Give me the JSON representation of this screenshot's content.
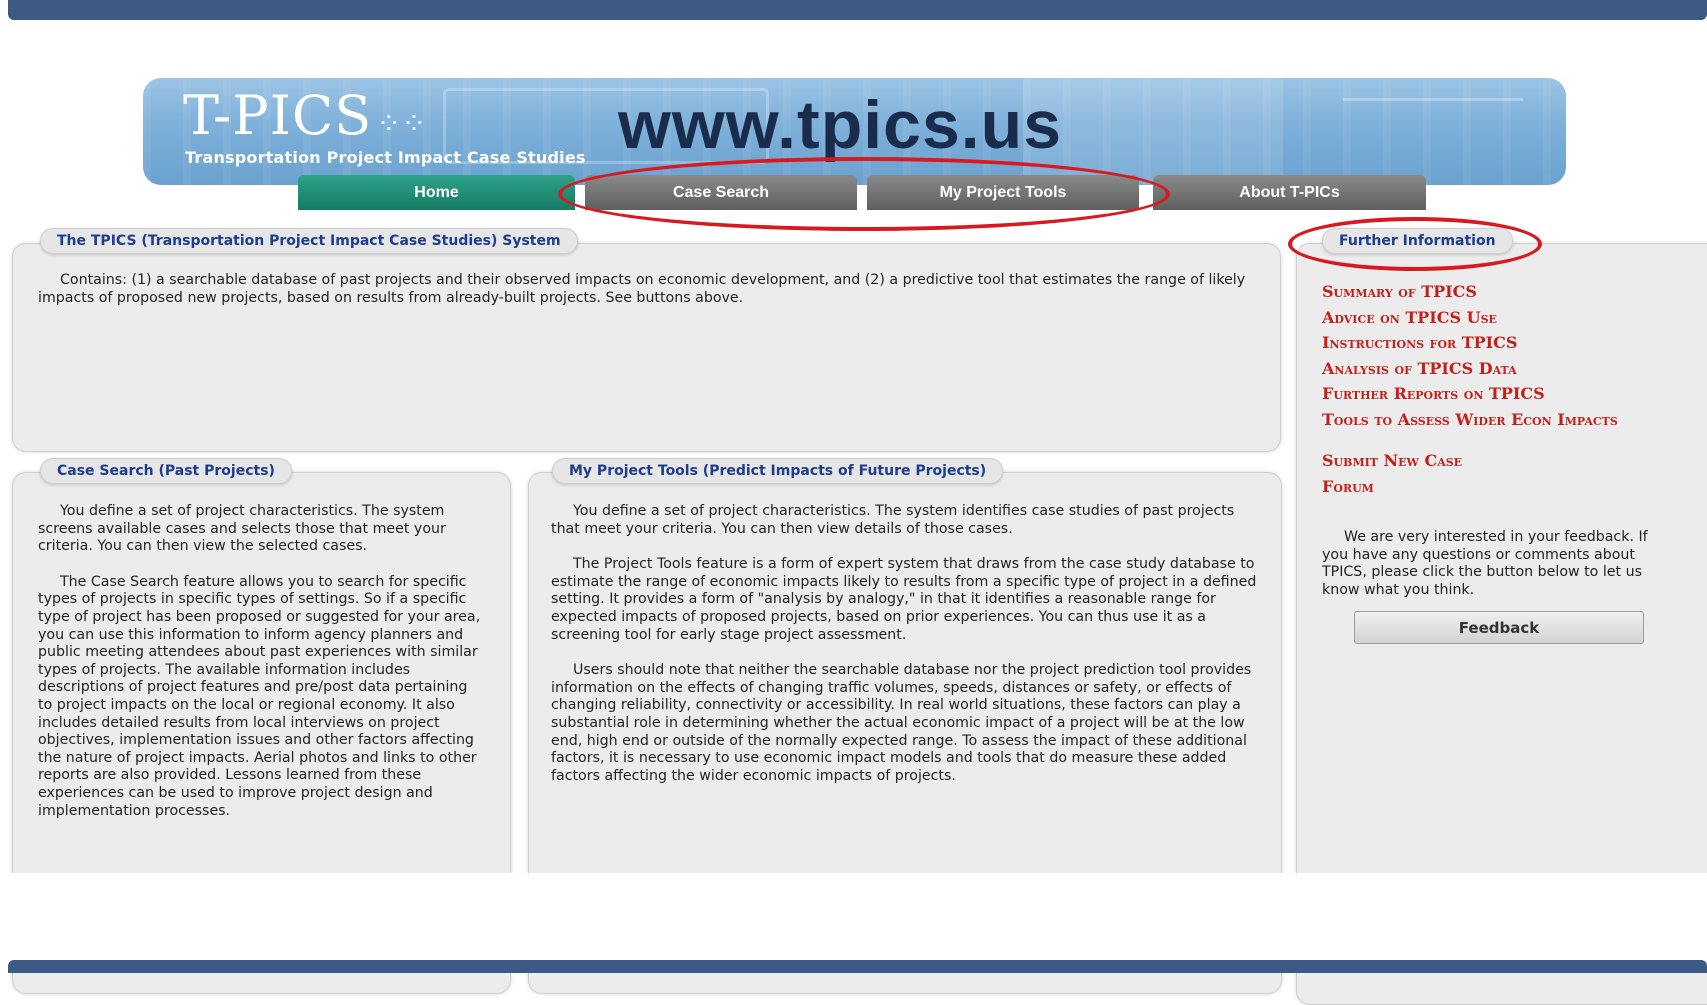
{
  "header": {
    "logo_mark": "T-PICS",
    "logo_dots": "⁘⁘",
    "logo_subtitle": "Transportation Project Impact Case Studies",
    "site_url": "www.tpics.us"
  },
  "nav": [
    {
      "label": "Home",
      "color": "#1f8d74"
    },
    {
      "label": "Case Search",
      "color": "#707070"
    },
    {
      "label": "My Project Tools",
      "color": "#707070"
    },
    {
      "label": "About T-PICs",
      "color": "#707070"
    }
  ],
  "main": {
    "title": "The TPICS (Transportation Project Impact Case Studies) System",
    "body": "Contains: (1) a searchable database of past projects and their observed impacts on economic development, and (2) a predictive tool that estimates the range of likely impacts of proposed new projects, based on results from already-built projects. See buttons above."
  },
  "case_search": {
    "title": "Case Search (Past Projects)",
    "paragraphs": [
      "You define a set of project characteristics. The system screens available cases and selects those that meet your criteria. You can then view the selected cases.",
      "The Case Search feature allows you to search for specific types of projects in specific types of settings. So if a specific type of project has been proposed or suggested for your area, you can use this information to inform agency planners and public meeting attendees about past experiences with similar types of projects. The available information includes descriptions of project features and pre/post data pertaining to project impacts on the local or regional economy. It also includes detailed results from local interviews on project objectives, implementation issues and other factors affecting the nature of project impacts. Aerial photos and links to other reports are also provided. Lessons learned from these experiences can be used to improve project design and implementation processes."
    ]
  },
  "project_tools": {
    "title": "My Project Tools (Predict Impacts of Future Projects)",
    "paragraphs": [
      "You define a set of project characteristics. The system identifies case studies of past projects that meet your criteria. You can then view details of those cases.",
      "The Project Tools feature is a form of expert system that draws from the case study database to estimate the range of economic impacts likely to results from a specific type of project in a defined setting. It provides a form of \"analysis by analogy,\" in that it identifies a reasonable range for expected impacts of proposed projects, based on prior experiences. You can thus use it as a screening tool for early stage project assessment.",
      "Users should note that neither the searchable database nor the project prediction tool provides information on the effects of changing traffic volumes, speeds, distances or safety, or effects of changing reliability, connectivity or accessibility. In real world situations, these factors can play a substantial role in determining whether the actual economic impact of a project will be at the low end, high end or outside of the normally expected range. To assess the impact of these additional factors, it is necessary to use economic impact models and tools that do measure these added factors affecting the wider economic impacts of projects."
    ]
  },
  "further_info": {
    "title": "Further Information",
    "links": [
      "Summary of TPICS",
      "Advice on TPICS Use",
      "Instructions for TPICS",
      "Analysis of TPICS Data",
      "Further Reports on TPICS",
      "Tools to Assess Wider Econ Impacts"
    ],
    "links2": [
      "Submit New Case",
      "Forum"
    ],
    "feedback_text": "We are very interested in your feedback. If you have any questions or comments about TPICS, please click the button below to let us know what you think.",
    "feedback_button": "Feedback"
  },
  "colors": {
    "accent_blue": "#3d5a85",
    "highlight_red": "#d8191f",
    "link_red": "#c4201b",
    "tab_title_blue": "#1e3d8f"
  }
}
